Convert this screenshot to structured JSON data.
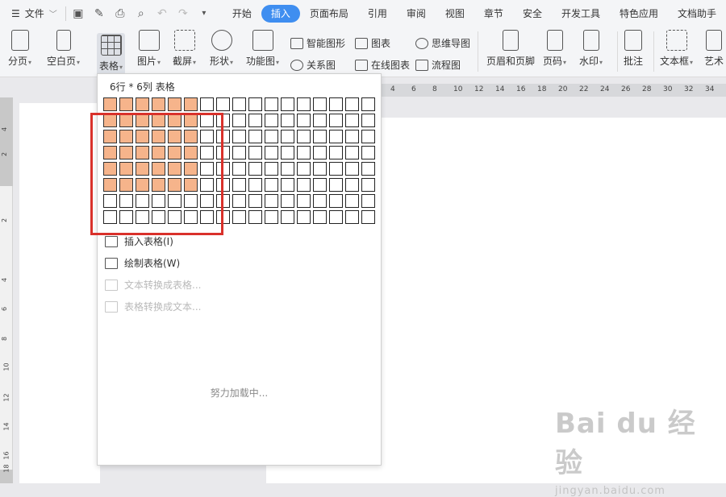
{
  "menubar": {
    "file_label": "文件",
    "tabs": [
      {
        "label": "开始",
        "active": false
      },
      {
        "label": "插入",
        "active": true
      },
      {
        "label": "页面布局",
        "active": false
      },
      {
        "label": "引用",
        "active": false
      },
      {
        "label": "审阅",
        "active": false
      },
      {
        "label": "视图",
        "active": false
      },
      {
        "label": "章节",
        "active": false
      },
      {
        "label": "安全",
        "active": false
      },
      {
        "label": "开发工具",
        "active": false
      },
      {
        "label": "特色应用",
        "active": false
      },
      {
        "label": "文档助手",
        "active": false
      }
    ]
  },
  "ribbon": {
    "page_break": "分页",
    "blank_page": "空白页",
    "table": "表格",
    "picture": "图片",
    "screenshot": "截屏",
    "shape": "形状",
    "function_chart": "功能图",
    "smart_shape": "智能图形",
    "chart": "图表",
    "mind_map": "思维导图",
    "relation_chart": "关系图",
    "online_chart": "在线图表",
    "flowchart": "流程图",
    "header_footer": "页眉和页脚",
    "page_number": "页码",
    "watermark": "水印",
    "comment": "批注",
    "textbox": "文本框",
    "art_text": "艺术"
  },
  "dropdown": {
    "title": "6行 * 6列 表格",
    "rows": 8,
    "cols": 17,
    "selected_rows": 6,
    "selected_cols": 6,
    "items": [
      {
        "label": "插入表格(I)",
        "disabled": false
      },
      {
        "label": "绘制表格(W)",
        "disabled": false
      },
      {
        "label": "文本转换成表格...",
        "disabled": true
      },
      {
        "label": "表格转换成文本...",
        "disabled": true
      }
    ],
    "loading": "努力加载中..."
  },
  "hruler_ticks": [
    "4",
    "6",
    "8",
    "10",
    "12",
    "14",
    "16",
    "18",
    "20",
    "22",
    "24",
    "26",
    "28",
    "30",
    "32",
    "34"
  ],
  "vruler_ticks": [
    "4",
    "2",
    "2",
    "4",
    "6",
    "8",
    "10",
    "12",
    "14",
    "16",
    "18"
  ],
  "watermark": {
    "brand": "Bai du 经验",
    "url": "jingyan.baidu.com"
  }
}
